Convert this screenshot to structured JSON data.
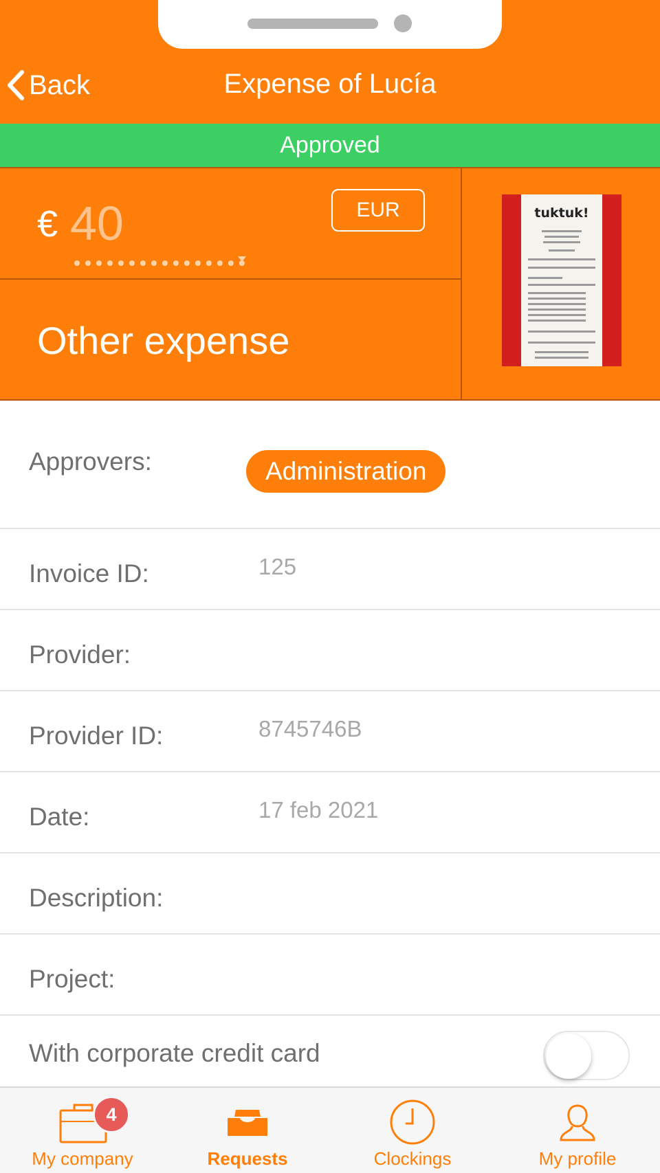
{
  "header": {
    "back_label": "Back",
    "title": "Expense of Lucía"
  },
  "status": {
    "label": "Approved",
    "color": "#3ccf63"
  },
  "summary": {
    "currency_symbol": "€",
    "amount": "40",
    "currency_code": "EUR",
    "expense_type": "Other expense",
    "receipt_brand": "tuktuk!"
  },
  "details": {
    "approvers_label": "Approvers:",
    "approvers_value": "Administration",
    "invoice_id_label": "Invoice ID:",
    "invoice_id_value": "125",
    "provider_label": "Provider:",
    "provider_id_label": "Provider ID:",
    "provider_id_value": "8745746B",
    "date_label": "Date:",
    "date_value": "17 feb 2021",
    "description_label": "Description:",
    "project_label": "Project:",
    "corporate_card_label": "With corporate credit card",
    "corporate_card_enabled": false
  },
  "tabbar": {
    "tabs": [
      {
        "label": "My company",
        "icon": "briefcase-icon",
        "badge": "4"
      },
      {
        "label": "Requests",
        "icon": "inbox-tray-icon",
        "active": true
      },
      {
        "label": "Clockings",
        "icon": "clock-icon"
      },
      {
        "label": "My profile",
        "icon": "user-icon"
      }
    ]
  },
  "colors": {
    "brand": "#ff7f0a",
    "approved": "#3ccf63",
    "badge": "#e65a58"
  }
}
